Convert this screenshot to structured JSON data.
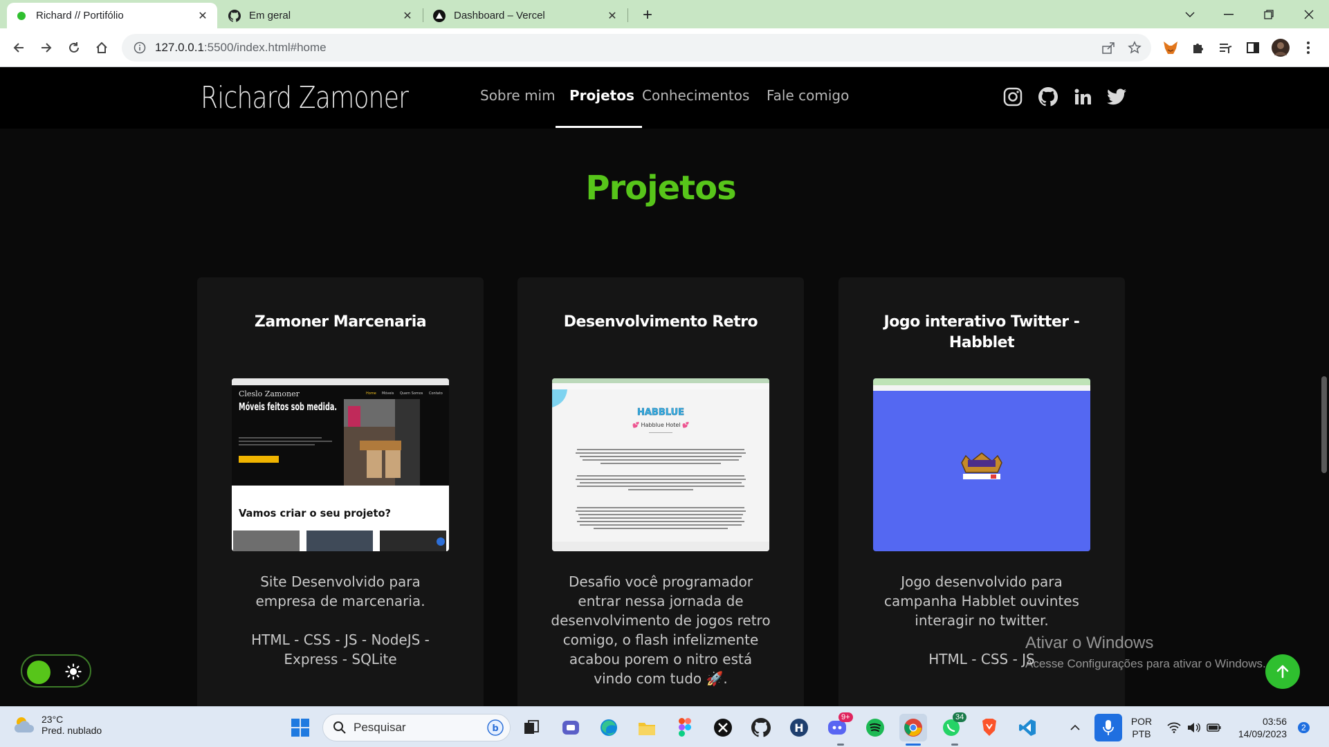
{
  "browser": {
    "tabs": [
      {
        "title": "Richard // Portifólio",
        "active": true
      },
      {
        "title": "Em geral",
        "active": false
      },
      {
        "title": "Dashboard – Vercel",
        "active": false
      }
    ],
    "url_host": "127.0.0.1",
    "url_rest": ":5500/index.html#home"
  },
  "site": {
    "brand": "Richard Zamoner",
    "nav": [
      "Sobre mim",
      "Projetos",
      "Conhecimentos",
      "Fale comigo"
    ],
    "active_nav": "Projetos",
    "social_icons": [
      "instagram-icon",
      "github-icon",
      "linkedin-icon",
      "twitter-icon"
    ],
    "section_title": "Projetos",
    "accent_color": "#57c51a",
    "projects": [
      {
        "title": "Zamoner Marcenaria",
        "description": "Site Desenvolvido para\nempresa de marcenaria.\n\nHTML - CSS - JS - NodeJS -\nExpress - SQLite"
      },
      {
        "title": "Desenvolvimento Retro",
        "description": "Desafio você programador\nentrar nessa jornada de\ndesenvolvimento de jogos retro\ncomigo, o flash infelizmente\nacabou porem o nitro está\nvindo com tudo 🚀."
      },
      {
        "title": "Jogo interativo Twitter -\nHabblet",
        "description": "Jogo desenvolvido para\ncampanha Habblet ouvintes\ninteragir no twitter.\n\nHTML - CSS - JS"
      }
    ],
    "thumb1": {
      "brand": "Cleslo Zamoner",
      "menu": [
        "Home",
        "Móveis",
        "Quem Somos",
        "Contato"
      ],
      "headline": "Móveis feitos sob medida.",
      "cta": "Vamos criar o seu projeto?"
    },
    "thumb2": {
      "logo": "HABBLUE",
      "subtitle": "💕 Habblue Hotel 💕"
    }
  },
  "watermark": {
    "title": "Ativar o Windows",
    "subtitle": "Acesse Configurações para ativar o Windows."
  },
  "taskbar": {
    "temperature": "23°C",
    "condition": "Pred. nublado",
    "search_placeholder": "Pesquisar",
    "discord_badge": "9+",
    "whatsapp_badge": "34",
    "lang_line1": "POR",
    "lang_line2": "PTB",
    "time": "03:56",
    "date": "14/09/2023",
    "notifications": "2"
  }
}
